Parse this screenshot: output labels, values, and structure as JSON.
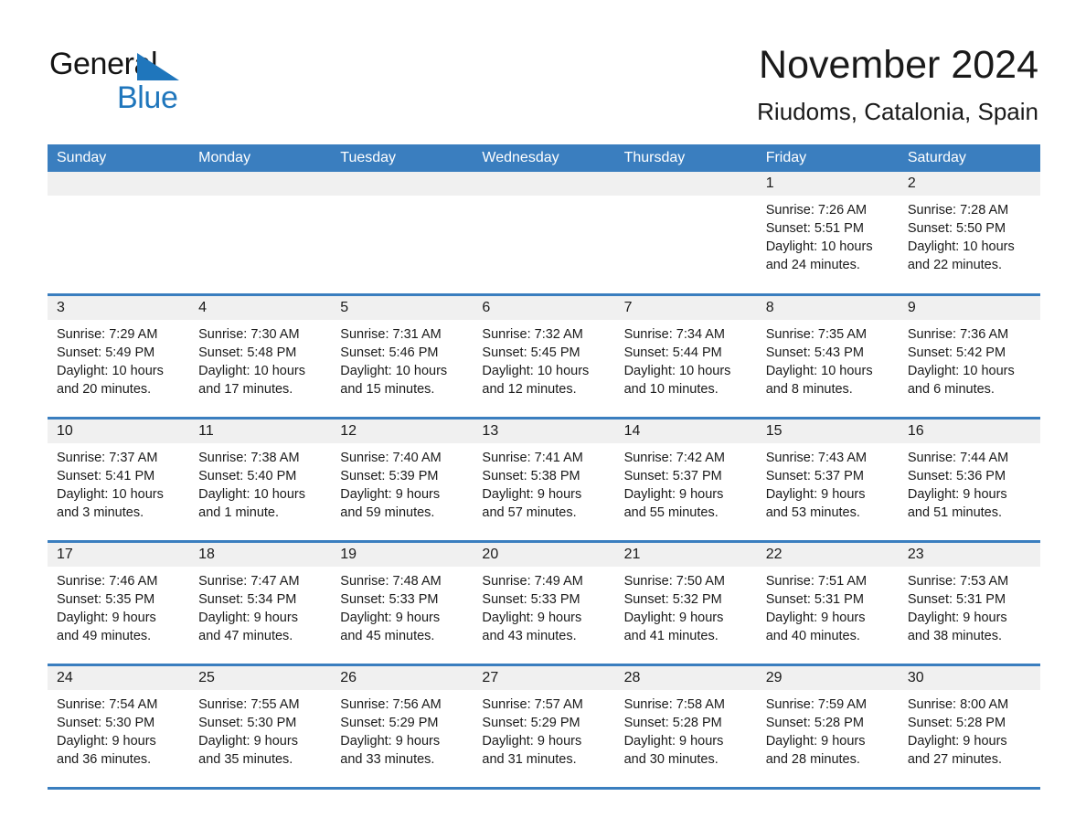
{
  "brand": {
    "name_part1": "General",
    "name_part2": "Blue",
    "accent_color": "#1f76bc",
    "triangle_icon": "triangle-icon"
  },
  "header": {
    "month_title": "November 2024",
    "location": "Riudoms, Catalonia, Spain"
  },
  "calendar": {
    "header_color": "#3a7ebf",
    "daynum_band_color": "#f0f0f0",
    "weekdays": [
      "Sunday",
      "Monday",
      "Tuesday",
      "Wednesday",
      "Thursday",
      "Friday",
      "Saturday"
    ],
    "weeks": [
      [
        {
          "day": "",
          "sunrise": "",
          "sunset": "",
          "daylight1": "",
          "daylight2": "",
          "empty": true
        },
        {
          "day": "",
          "sunrise": "",
          "sunset": "",
          "daylight1": "",
          "daylight2": "",
          "empty": true
        },
        {
          "day": "",
          "sunrise": "",
          "sunset": "",
          "daylight1": "",
          "daylight2": "",
          "empty": true
        },
        {
          "day": "",
          "sunrise": "",
          "sunset": "",
          "daylight1": "",
          "daylight2": "",
          "empty": true
        },
        {
          "day": "",
          "sunrise": "",
          "sunset": "",
          "daylight1": "",
          "daylight2": "",
          "empty": true
        },
        {
          "day": "1",
          "sunrise": "Sunrise: 7:26 AM",
          "sunset": "Sunset: 5:51 PM",
          "daylight1": "Daylight: 10 hours",
          "daylight2": "and 24 minutes.",
          "empty": false
        },
        {
          "day": "2",
          "sunrise": "Sunrise: 7:28 AM",
          "sunset": "Sunset: 5:50 PM",
          "daylight1": "Daylight: 10 hours",
          "daylight2": "and 22 minutes.",
          "empty": false
        }
      ],
      [
        {
          "day": "3",
          "sunrise": "Sunrise: 7:29 AM",
          "sunset": "Sunset: 5:49 PM",
          "daylight1": "Daylight: 10 hours",
          "daylight2": "and 20 minutes.",
          "empty": false
        },
        {
          "day": "4",
          "sunrise": "Sunrise: 7:30 AM",
          "sunset": "Sunset: 5:48 PM",
          "daylight1": "Daylight: 10 hours",
          "daylight2": "and 17 minutes.",
          "empty": false
        },
        {
          "day": "5",
          "sunrise": "Sunrise: 7:31 AM",
          "sunset": "Sunset: 5:46 PM",
          "daylight1": "Daylight: 10 hours",
          "daylight2": "and 15 minutes.",
          "empty": false
        },
        {
          "day": "6",
          "sunrise": "Sunrise: 7:32 AM",
          "sunset": "Sunset: 5:45 PM",
          "daylight1": "Daylight: 10 hours",
          "daylight2": "and 12 minutes.",
          "empty": false
        },
        {
          "day": "7",
          "sunrise": "Sunrise: 7:34 AM",
          "sunset": "Sunset: 5:44 PM",
          "daylight1": "Daylight: 10 hours",
          "daylight2": "and 10 minutes.",
          "empty": false
        },
        {
          "day": "8",
          "sunrise": "Sunrise: 7:35 AM",
          "sunset": "Sunset: 5:43 PM",
          "daylight1": "Daylight: 10 hours",
          "daylight2": "and 8 minutes.",
          "empty": false
        },
        {
          "day": "9",
          "sunrise": "Sunrise: 7:36 AM",
          "sunset": "Sunset: 5:42 PM",
          "daylight1": "Daylight: 10 hours",
          "daylight2": "and 6 minutes.",
          "empty": false
        }
      ],
      [
        {
          "day": "10",
          "sunrise": "Sunrise: 7:37 AM",
          "sunset": "Sunset: 5:41 PM",
          "daylight1": "Daylight: 10 hours",
          "daylight2": "and 3 minutes.",
          "empty": false
        },
        {
          "day": "11",
          "sunrise": "Sunrise: 7:38 AM",
          "sunset": "Sunset: 5:40 PM",
          "daylight1": "Daylight: 10 hours",
          "daylight2": "and 1 minute.",
          "empty": false
        },
        {
          "day": "12",
          "sunrise": "Sunrise: 7:40 AM",
          "sunset": "Sunset: 5:39 PM",
          "daylight1": "Daylight: 9 hours",
          "daylight2": "and 59 minutes.",
          "empty": false
        },
        {
          "day": "13",
          "sunrise": "Sunrise: 7:41 AM",
          "sunset": "Sunset: 5:38 PM",
          "daylight1": "Daylight: 9 hours",
          "daylight2": "and 57 minutes.",
          "empty": false
        },
        {
          "day": "14",
          "sunrise": "Sunrise: 7:42 AM",
          "sunset": "Sunset: 5:37 PM",
          "daylight1": "Daylight: 9 hours",
          "daylight2": "and 55 minutes.",
          "empty": false
        },
        {
          "day": "15",
          "sunrise": "Sunrise: 7:43 AM",
          "sunset": "Sunset: 5:37 PM",
          "daylight1": "Daylight: 9 hours",
          "daylight2": "and 53 minutes.",
          "empty": false
        },
        {
          "day": "16",
          "sunrise": "Sunrise: 7:44 AM",
          "sunset": "Sunset: 5:36 PM",
          "daylight1": "Daylight: 9 hours",
          "daylight2": "and 51 minutes.",
          "empty": false
        }
      ],
      [
        {
          "day": "17",
          "sunrise": "Sunrise: 7:46 AM",
          "sunset": "Sunset: 5:35 PM",
          "daylight1": "Daylight: 9 hours",
          "daylight2": "and 49 minutes.",
          "empty": false
        },
        {
          "day": "18",
          "sunrise": "Sunrise: 7:47 AM",
          "sunset": "Sunset: 5:34 PM",
          "daylight1": "Daylight: 9 hours",
          "daylight2": "and 47 minutes.",
          "empty": false
        },
        {
          "day": "19",
          "sunrise": "Sunrise: 7:48 AM",
          "sunset": "Sunset: 5:33 PM",
          "daylight1": "Daylight: 9 hours",
          "daylight2": "and 45 minutes.",
          "empty": false
        },
        {
          "day": "20",
          "sunrise": "Sunrise: 7:49 AM",
          "sunset": "Sunset: 5:33 PM",
          "daylight1": "Daylight: 9 hours",
          "daylight2": "and 43 minutes.",
          "empty": false
        },
        {
          "day": "21",
          "sunrise": "Sunrise: 7:50 AM",
          "sunset": "Sunset: 5:32 PM",
          "daylight1": "Daylight: 9 hours",
          "daylight2": "and 41 minutes.",
          "empty": false
        },
        {
          "day": "22",
          "sunrise": "Sunrise: 7:51 AM",
          "sunset": "Sunset: 5:31 PM",
          "daylight1": "Daylight: 9 hours",
          "daylight2": "and 40 minutes.",
          "empty": false
        },
        {
          "day": "23",
          "sunrise": "Sunrise: 7:53 AM",
          "sunset": "Sunset: 5:31 PM",
          "daylight1": "Daylight: 9 hours",
          "daylight2": "and 38 minutes.",
          "empty": false
        }
      ],
      [
        {
          "day": "24",
          "sunrise": "Sunrise: 7:54 AM",
          "sunset": "Sunset: 5:30 PM",
          "daylight1": "Daylight: 9 hours",
          "daylight2": "and 36 minutes.",
          "empty": false
        },
        {
          "day": "25",
          "sunrise": "Sunrise: 7:55 AM",
          "sunset": "Sunset: 5:30 PM",
          "daylight1": "Daylight: 9 hours",
          "daylight2": "and 35 minutes.",
          "empty": false
        },
        {
          "day": "26",
          "sunrise": "Sunrise: 7:56 AM",
          "sunset": "Sunset: 5:29 PM",
          "daylight1": "Daylight: 9 hours",
          "daylight2": "and 33 minutes.",
          "empty": false
        },
        {
          "day": "27",
          "sunrise": "Sunrise: 7:57 AM",
          "sunset": "Sunset: 5:29 PM",
          "daylight1": "Daylight: 9 hours",
          "daylight2": "and 31 minutes.",
          "empty": false
        },
        {
          "day": "28",
          "sunrise": "Sunrise: 7:58 AM",
          "sunset": "Sunset: 5:28 PM",
          "daylight1": "Daylight: 9 hours",
          "daylight2": "and 30 minutes.",
          "empty": false
        },
        {
          "day": "29",
          "sunrise": "Sunrise: 7:59 AM",
          "sunset": "Sunset: 5:28 PM",
          "daylight1": "Daylight: 9 hours",
          "daylight2": "and 28 minutes.",
          "empty": false
        },
        {
          "day": "30",
          "sunrise": "Sunrise: 8:00 AM",
          "sunset": "Sunset: 5:28 PM",
          "daylight1": "Daylight: 9 hours",
          "daylight2": "and 27 minutes.",
          "empty": false
        }
      ]
    ]
  }
}
